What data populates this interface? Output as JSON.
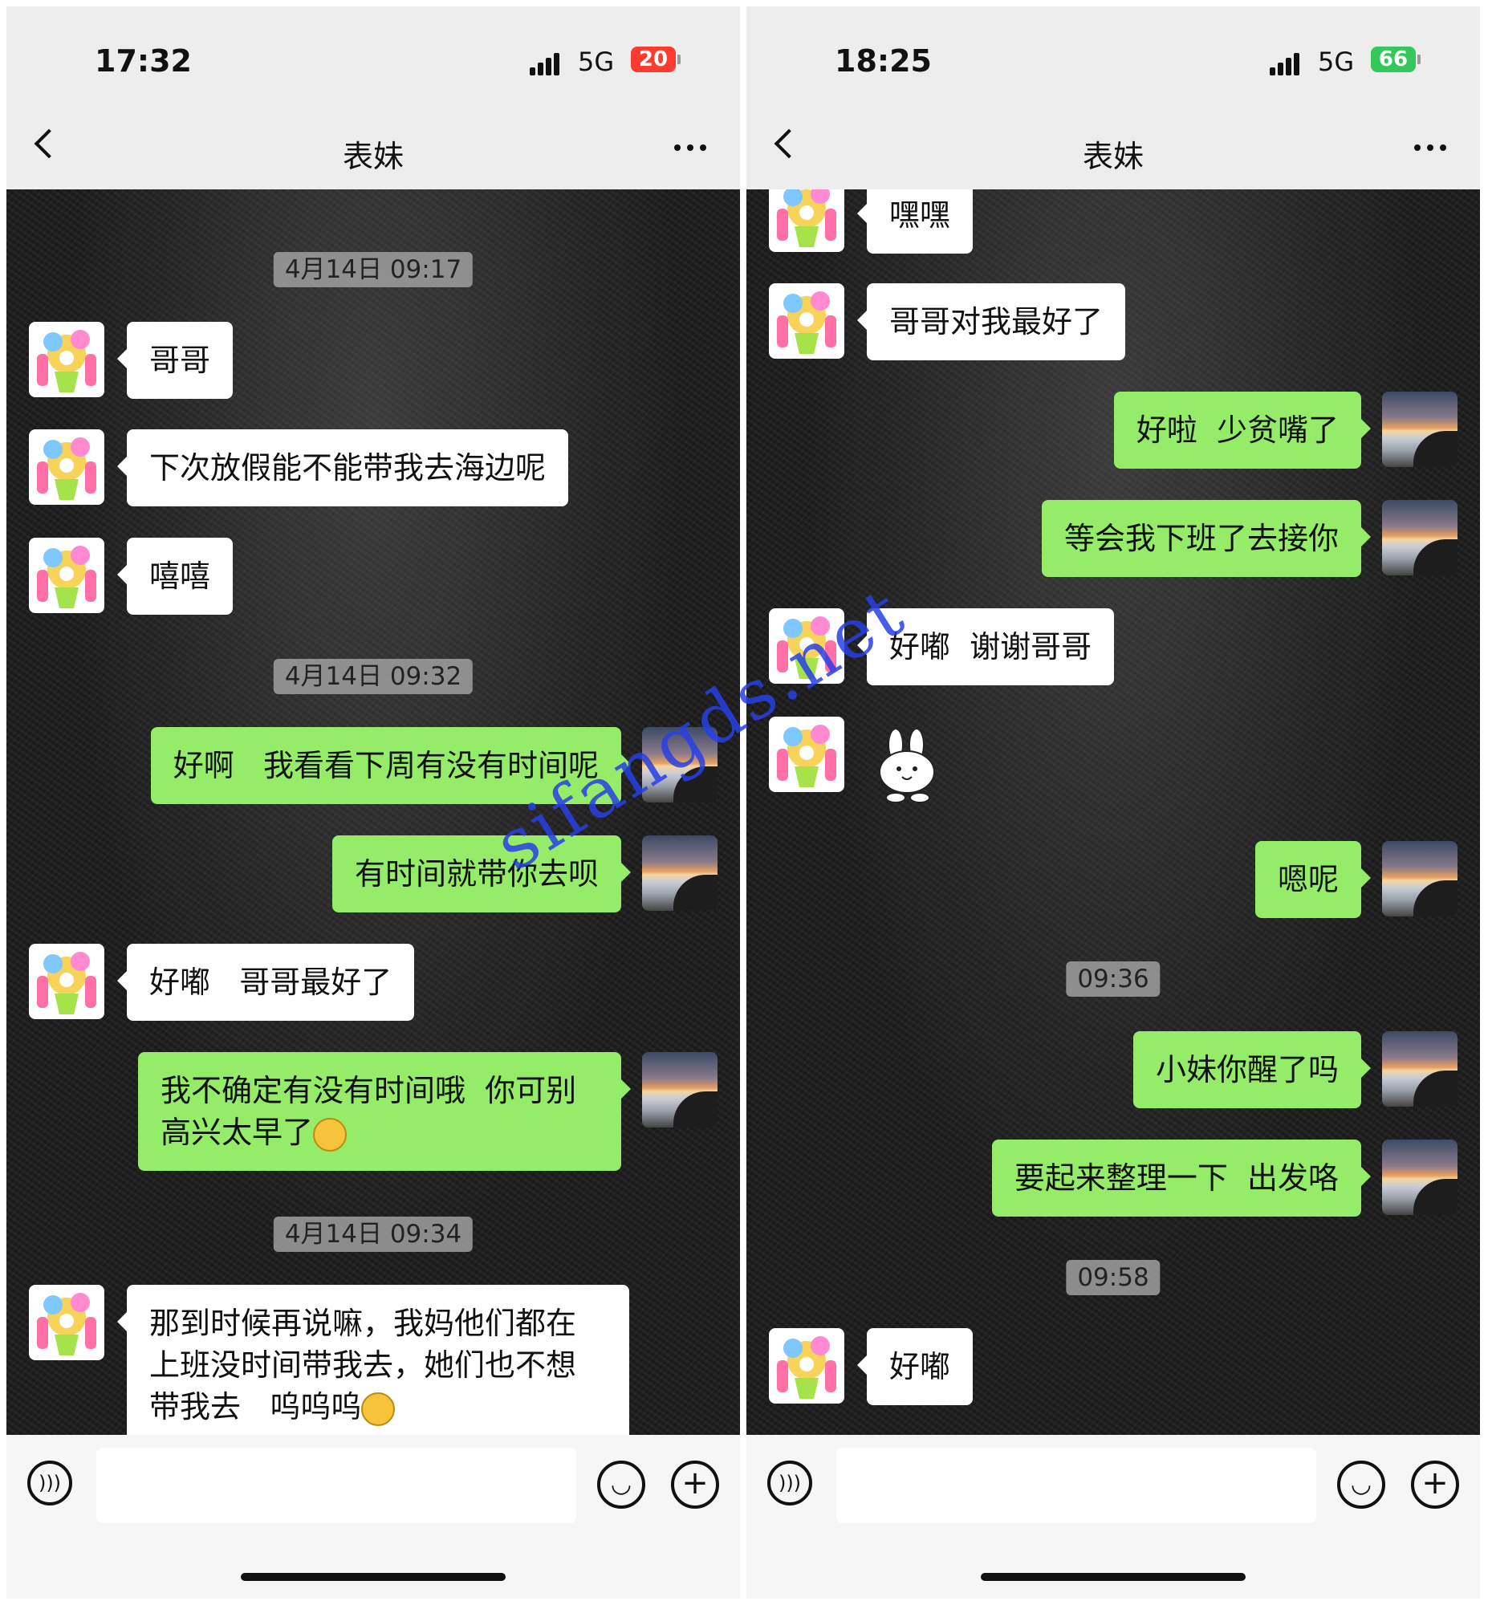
{
  "left": {
    "status": {
      "time": "17:32",
      "network": "5G",
      "battery": "20",
      "battery_color": "#ff3b30"
    },
    "nav": {
      "title": "表妹"
    },
    "stamps": [
      "4月14日 09:17",
      "4月14日 09:32",
      "4月14日 09:34"
    ],
    "messages": [
      "哥哥",
      "下次放假能不能带我去海边呢",
      "嘻嘻",
      "好啊   我看看下周有没有时间呢",
      "有时间就带你去呗",
      "好嘟   哥哥最好了",
      "我不确定有没有时间哦  你可别\n高兴太早了",
      "那到时候再说嘛，我妈他们都在\n上班没时间带我去，她们也不想\n带我去   呜呜呜"
    ]
  },
  "right": {
    "status": {
      "time": "18:25",
      "network": "5G",
      "battery": "66",
      "battery_color": "#34c759"
    },
    "nav": {
      "title": "表妹"
    },
    "stamps": [
      "09:36",
      "09:58"
    ],
    "messages": [
      "嘿嘿",
      "哥哥对我最好了",
      "好啦  少贫嘴了",
      "等会我下班了去接你",
      "好嘟  谢谢哥哥",
      "嗯呢",
      "小妹你醒了吗",
      "要起来整理一下  出发咯",
      "好嘟"
    ]
  },
  "watermark": "sifangds.net",
  "icons": [
    "back-icon",
    "more-icon",
    "voice-icon",
    "emoji-icon",
    "plus-icon",
    "signal-icon",
    "battery-icon"
  ],
  "colors": {
    "bubble_me": "#95ec69",
    "bubble_her": "#ffffff",
    "bar": "#ededed"
  }
}
